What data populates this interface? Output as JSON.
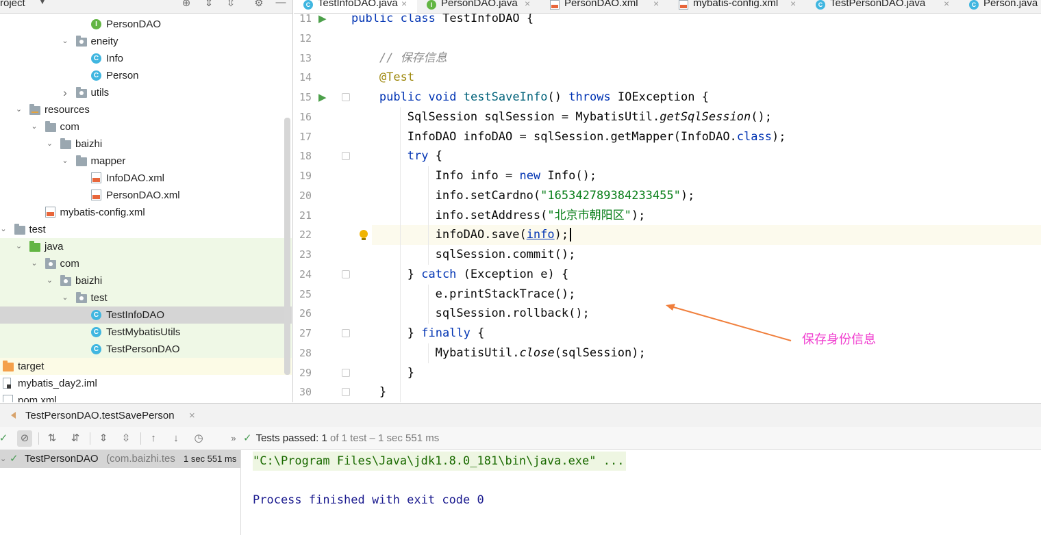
{
  "project": {
    "title": "roject",
    "tree": [
      {
        "label": "PersonDAO",
        "icon": "interface-icon",
        "level": 6,
        "arrow": ""
      },
      {
        "label": "eneity",
        "icon": "package-icon",
        "level": 5,
        "arrow": "down"
      },
      {
        "label": "Info",
        "icon": "class-icon",
        "level": 6,
        "arrow": ""
      },
      {
        "label": "Person",
        "icon": "class-icon",
        "level": 6,
        "arrow": ""
      },
      {
        "label": "utils",
        "icon": "package-icon",
        "level": 5,
        "arrow": "right"
      },
      {
        "label": "resources",
        "icon": "resources-folder-icon",
        "level": 2,
        "arrow": "down"
      },
      {
        "label": "com",
        "icon": "folder-icon",
        "level": 3,
        "arrow": "down"
      },
      {
        "label": "baizhi",
        "icon": "folder-icon",
        "level": 4,
        "arrow": "down"
      },
      {
        "label": "mapper",
        "icon": "folder-icon",
        "level": 5,
        "arrow": "down"
      },
      {
        "label": "InfoDAO.xml",
        "icon": "xml-file-icon",
        "level": 6,
        "arrow": ""
      },
      {
        "label": "PersonDAO.xml",
        "icon": "xml-file-icon",
        "level": 6,
        "arrow": ""
      },
      {
        "label": "mybatis-config.xml",
        "icon": "xml-file-icon",
        "level": 3,
        "arrow": ""
      },
      {
        "label": "test",
        "icon": "folder-icon",
        "level": 1,
        "arrow": "down"
      },
      {
        "label": "java",
        "icon": "test-source-folder-icon",
        "level": 2,
        "arrow": "down",
        "bg": "green"
      },
      {
        "label": "com",
        "icon": "package-icon",
        "level": 3,
        "arrow": "down",
        "bg": "green"
      },
      {
        "label": "baizhi",
        "icon": "package-icon",
        "level": 4,
        "arrow": "down",
        "bg": "green"
      },
      {
        "label": "test",
        "icon": "package-icon",
        "level": 5,
        "arrow": "down",
        "bg": "green"
      },
      {
        "label": "TestInfoDAO",
        "icon": "test-class-icon",
        "level": 6,
        "arrow": "",
        "bg": "selected"
      },
      {
        "label": "TestMybatisUtils",
        "icon": "test-class-icon",
        "level": 6,
        "arrow": "",
        "bg": "green"
      },
      {
        "label": "TestPersonDAO",
        "icon": "test-class-icon",
        "level": 6,
        "arrow": "",
        "bg": "green"
      },
      {
        "label": "target",
        "icon": "excluded-folder-icon",
        "level": 0,
        "arrow": "",
        "bg": "yellow"
      },
      {
        "label": "mybatis_day2.iml",
        "icon": "iml-file-icon",
        "level": 0,
        "arrow": ""
      },
      {
        "label": "pom.xml",
        "icon": "pom-file-icon",
        "level": 0,
        "arrow": ""
      }
    ]
  },
  "editor_tabs": [
    {
      "label": "TestInfoDAO.java",
      "icon": "c",
      "active": true
    },
    {
      "label": "PersonDAO.java",
      "icon": "i",
      "active": false
    },
    {
      "label": "PersonDAO.xml",
      "icon": "x",
      "active": false
    },
    {
      "label": "mybatis-config.xml",
      "icon": "x",
      "active": false
    },
    {
      "label": "TestPersonDAO.java",
      "icon": "c",
      "active": false
    },
    {
      "label": "Person.java",
      "icon": "c",
      "active": false
    }
  ],
  "editor": {
    "current_line": 22,
    "lines": [
      {
        "num": "11",
        "indent": 0,
        "tokens": [
          {
            "t": "public ",
            "c": "kw"
          },
          {
            "t": "class ",
            "c": "kw"
          },
          {
            "t": "TestInfoDAO {",
            "c": ""
          }
        ]
      },
      {
        "num": "12",
        "indent": 0,
        "tokens": []
      },
      {
        "num": "13",
        "indent": 1,
        "tokens": [
          {
            "t": "// 保存信息",
            "c": "cmt"
          }
        ]
      },
      {
        "num": "14",
        "indent": 1,
        "tokens": [
          {
            "t": "@Test",
            "c": "ann"
          }
        ]
      },
      {
        "num": "15",
        "indent": 1,
        "tokens": [
          {
            "t": "public ",
            "c": "kw"
          },
          {
            "t": "void ",
            "c": "kw"
          },
          {
            "t": "testSaveInfo",
            "c": "mth"
          },
          {
            "t": "() ",
            "c": ""
          },
          {
            "t": "throws ",
            "c": "kw"
          },
          {
            "t": "IOException {",
            "c": ""
          }
        ]
      },
      {
        "num": "16",
        "indent": 2,
        "tokens": [
          {
            "t": "SqlSession sqlSession = MybatisUtil.",
            "c": ""
          },
          {
            "t": "getSqlSession",
            "c": "ital"
          },
          {
            "t": "();",
            "c": ""
          }
        ]
      },
      {
        "num": "17",
        "indent": 2,
        "tokens": [
          {
            "t": "InfoDAO infoDAO = sqlSession.getMapper(InfoDAO.",
            "c": ""
          },
          {
            "t": "class",
            "c": "kw"
          },
          {
            "t": ");",
            "c": ""
          }
        ]
      },
      {
        "num": "18",
        "indent": 2,
        "tokens": [
          {
            "t": "try ",
            "c": "kw"
          },
          {
            "t": "{",
            "c": ""
          }
        ]
      },
      {
        "num": "19",
        "indent": 3,
        "tokens": [
          {
            "t": "Info info = ",
            "c": ""
          },
          {
            "t": "new ",
            "c": "kw"
          },
          {
            "t": "Info();",
            "c": ""
          }
        ]
      },
      {
        "num": "20",
        "indent": 3,
        "tokens": [
          {
            "t": "info.setCardno(",
            "c": ""
          },
          {
            "t": "\"165342789384233455\"",
            "c": "str"
          },
          {
            "t": ");",
            "c": ""
          }
        ]
      },
      {
        "num": "21",
        "indent": 3,
        "tokens": [
          {
            "t": "info.setAddress(",
            "c": ""
          },
          {
            "t": "\"北京市朝阳区\"",
            "c": "str"
          },
          {
            "t": ");",
            "c": ""
          }
        ]
      },
      {
        "num": "22",
        "indent": 3,
        "tokens": [
          {
            "t": "infoDAO.save(",
            "c": ""
          },
          {
            "t": "info",
            "c": "ulink"
          },
          {
            "t": ");",
            "c": ""
          }
        ]
      },
      {
        "num": "23",
        "indent": 3,
        "tokens": [
          {
            "t": "sqlSession.commit();",
            "c": ""
          }
        ]
      },
      {
        "num": "24",
        "indent": 2,
        "tokens": [
          {
            "t": "} ",
            "c": ""
          },
          {
            "t": "catch ",
            "c": "kw"
          },
          {
            "t": "(Exception e) {",
            "c": ""
          }
        ]
      },
      {
        "num": "25",
        "indent": 3,
        "tokens": [
          {
            "t": "e.printStackTrace();",
            "c": ""
          }
        ]
      },
      {
        "num": "26",
        "indent": 3,
        "tokens": [
          {
            "t": "sqlSession.rollback();",
            "c": ""
          }
        ]
      },
      {
        "num": "27",
        "indent": 2,
        "tokens": [
          {
            "t": "} ",
            "c": ""
          },
          {
            "t": "finally ",
            "c": "kw"
          },
          {
            "t": "{",
            "c": ""
          }
        ]
      },
      {
        "num": "28",
        "indent": 3,
        "tokens": [
          {
            "t": "MybatisUtil.",
            "c": ""
          },
          {
            "t": "close",
            "c": "ital"
          },
          {
            "t": "(sqlSession);",
            "c": ""
          }
        ]
      },
      {
        "num": "29",
        "indent": 2,
        "tokens": [
          {
            "t": "}",
            "c": ""
          }
        ]
      },
      {
        "num": "30",
        "indent": 1,
        "tokens": [
          {
            "t": "}",
            "c": ""
          }
        ]
      }
    ]
  },
  "annotation": {
    "text": "保存身份信息",
    "color": "#f03ccf",
    "arrow_color": "#f07f3c"
  },
  "run": {
    "tab_label": "TestPersonDAO.testSavePerson",
    "status_prefix": "Tests passed: ",
    "status_count": "1",
    "status_suffix": " of 1 test – 1 sec 551 ms",
    "test_name": "TestPersonDAO",
    "test_package": "(com.baizhi.tes",
    "test_time": "1 sec 551 ms",
    "console_cmd": "\"C:\\Program Files\\Java\\jdk1.8.0_181\\bin\\java.exe\" ...",
    "console_exit": "Process finished with exit code 0"
  },
  "colors": {
    "keyword": "#0033b3",
    "string": "#067d17",
    "annotation": "#9e880d",
    "comment": "#8c8c8c",
    "test_green": "#eff8e6",
    "pass_green": "#499c54"
  }
}
